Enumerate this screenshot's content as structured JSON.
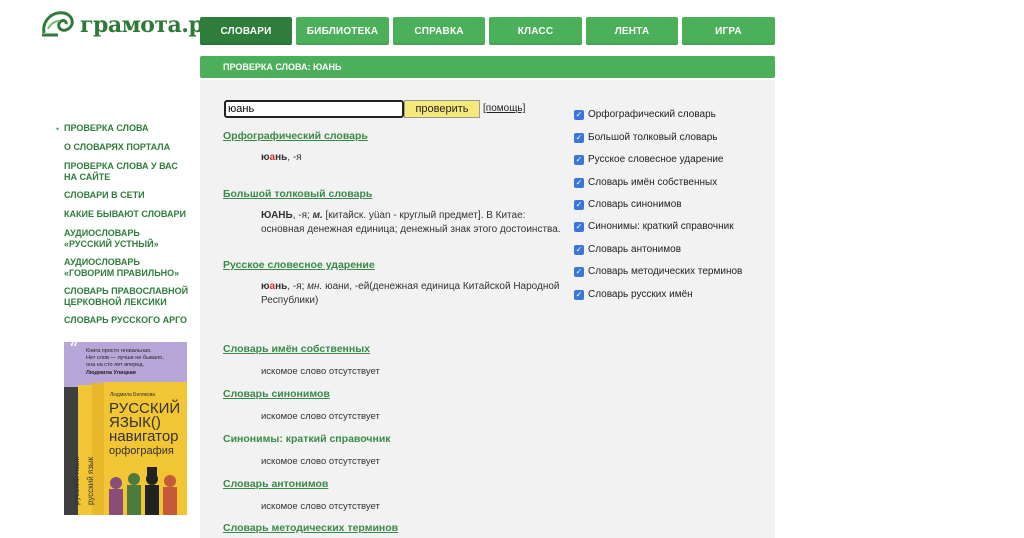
{
  "logo": {
    "text": "грамота.ру"
  },
  "nav": {
    "tabs": [
      {
        "label": "Словари",
        "active": true
      },
      {
        "label": "Библиотека",
        "active": false
      },
      {
        "label": "Справка",
        "active": false
      },
      {
        "label": "Класс",
        "active": false
      },
      {
        "label": "Лента",
        "active": false
      },
      {
        "label": "Игра",
        "active": false
      }
    ]
  },
  "header": {
    "title": "ПРОВЕРКА СЛОВА: ЮАНЬ"
  },
  "search": {
    "value": "юань",
    "button_label": "проверить",
    "help_label": "[помощь]"
  },
  "results": {
    "orfo": {
      "title": "Орфографический словарь",
      "hw_pre": "ю",
      "hw_stress": "а",
      "hw_post": "нь",
      "rest": ", -я"
    },
    "btsl": {
      "title": "Большой толковый словарь",
      "hw": "ЮАНЬ",
      "gram": ", -я; ",
      "gender": "м.",
      "line1": " [китайск. yüan - круглый предмет]. В Китае:",
      "line2": "основная денежная единица; денежный знак этого достоинства."
    },
    "stress_dict": {
      "title": "Русское словесное ударение",
      "hw_pre": "ю",
      "hw_stress": "а",
      "hw_post": "нь",
      "gram": ", -я; ",
      "pl": "мн.",
      "line1": " юани, -ей(денежная единица Китайской Народной",
      "line2": "Республики)"
    },
    "missing": [
      {
        "title": "Словарь имён собственных",
        "note": "искомое слово отсутствует",
        "underline": true
      },
      {
        "title": "Словарь синонимов",
        "note": "искомое слово отсутствует",
        "underline": true
      },
      {
        "title": "Синонимы: краткий справочник",
        "note": "искомое слово отсутствует",
        "underline": false
      },
      {
        "title": "Словарь антонимов",
        "note": "искомое слово отсутствует",
        "underline": true
      },
      {
        "title": "Словарь методических терминов",
        "note": "",
        "underline": true
      }
    ]
  },
  "checkboxes": [
    {
      "label": "Орфографический словарь",
      "checked": true
    },
    {
      "label": "Большой толковый словарь",
      "checked": true
    },
    {
      "label": "Русское словесное ударение",
      "checked": true
    },
    {
      "label": "Словарь имён собственных",
      "checked": true
    },
    {
      "label": "Словарь синонимов",
      "checked": true
    },
    {
      "label": "Синонимы: краткий справочник",
      "checked": true
    },
    {
      "label": "Словарь антонимов",
      "checked": true
    },
    {
      "label": "Словарь методических терминов",
      "checked": true
    },
    {
      "label": "Словарь русских имён",
      "checked": true
    }
  ],
  "sidebar": {
    "bullet": "•",
    "items": [
      "Проверка слова",
      "О словарях портала",
      "Проверка слова у вас на сайте",
      "Словари в сети",
      "Какие бывают словари",
      "Аудиословарь «Русский устный»",
      "Аудиословарь «Говорим правильно»",
      "Словарь православной церковной лексики",
      "Словарь русского арго"
    ]
  },
  "ad": {
    "quote_line1": "Книга просто гениальная.",
    "quote_line2": "Нет слов — лучше не бывало,",
    "quote_line3": "она на сто лет вперед.",
    "quote_author": "Людмила Улицкая",
    "book_author": "Людмила Белякова",
    "book_title_1": "РУССКИЙ",
    "book_title_2": "ЯЗЫК()",
    "book_title_3": "навигатор",
    "book_title_4": "орфография",
    "spine_1": "русский язык",
    "spine_2": "русский язык"
  },
  "colors": {
    "green": "#4caf5a",
    "dark_green": "#2f7d3a",
    "link_green": "#3a8a47",
    "button_yellow": "#f5e97a",
    "checkbox_blue": "#3b76d9"
  }
}
